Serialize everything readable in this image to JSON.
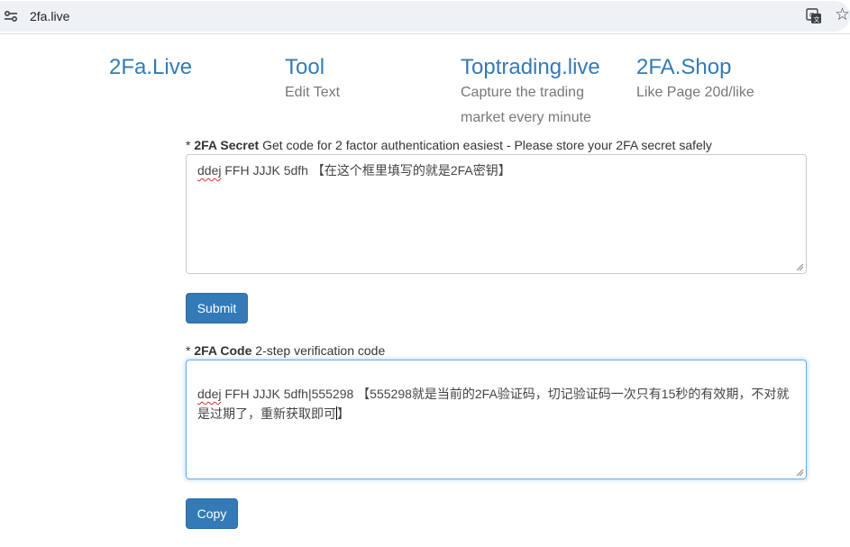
{
  "browser": {
    "url": "2fa.live",
    "site_icon": "tune-icon",
    "translate_icon": "translate-icon",
    "bookmark_icon": "star-icon"
  },
  "nav": [
    {
      "title": "2Fa.Live",
      "desc": ""
    },
    {
      "title": "Tool",
      "desc": "Edit Text"
    },
    {
      "title": "Toptrading.live",
      "desc": "Capture the trading market every minute"
    },
    {
      "title": "2FA.Shop",
      "desc": "Like Page 20d/like"
    }
  ],
  "secret": {
    "star": "* ",
    "label": "2FA Secret",
    "hint": " Get code for 2 factor authentication easiest - Please store your 2FA secret safely",
    "value_word": "ddej",
    "value_rest": " FFH JJJK 5dfh 【在这个框里填写的就是2FA密钥】",
    "submit_label": "Submit"
  },
  "code": {
    "star": "* ",
    "label": "2FA Code",
    "hint": " 2-step verification code",
    "value_word": "ddej",
    "value_rest": " FFH JJJK 5dfh|555298   【555298就是当前的2FA验证码，切记验证码一次只有15秒的有效期，不对就是过期了，重新获取即可",
    "value_end": "】",
    "copy_label": "Copy"
  },
  "colors": {
    "link": "#337ab7",
    "button": "#337ab7",
    "muted": "#777777",
    "focus": "#66afe9"
  }
}
